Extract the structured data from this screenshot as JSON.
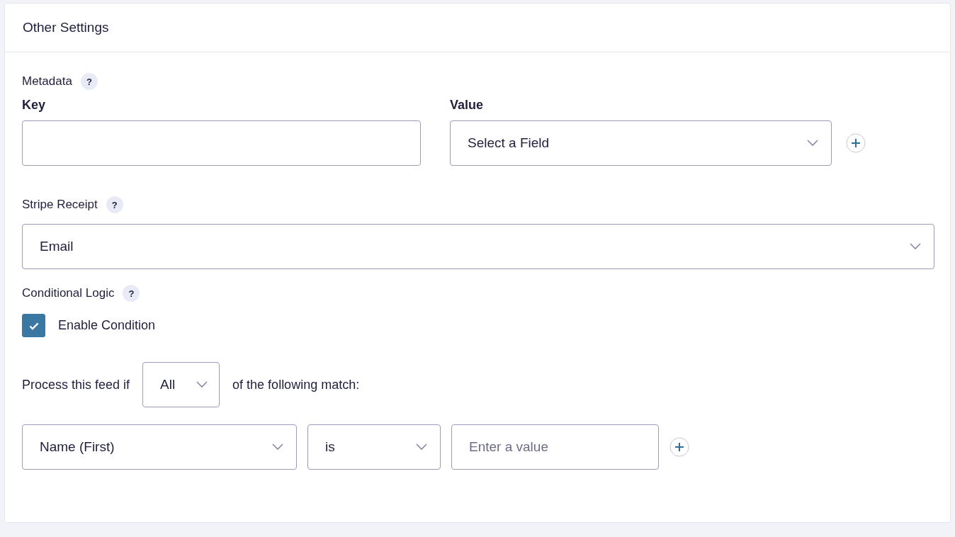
{
  "panel": {
    "title": "Other Settings"
  },
  "metadata": {
    "label": "Metadata",
    "help": "?",
    "key_label": "Key",
    "value_label": "Value",
    "value_select": "Select a Field"
  },
  "stripe_receipt": {
    "label": "Stripe Receipt",
    "help": "?",
    "select": "Email"
  },
  "conditional_logic": {
    "label": "Conditional Logic",
    "help": "?",
    "enable": {
      "label": "Enable Condition",
      "checked": true
    },
    "process_before": "Process this feed if",
    "match_select": "All",
    "process_after": "of the following match:",
    "rule": {
      "field": "Name (First)",
      "operator": "is",
      "value_placeholder": "Enter a value"
    }
  }
}
